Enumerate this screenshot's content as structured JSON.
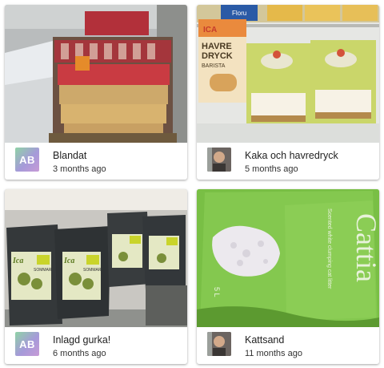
{
  "posts": [
    {
      "title": "Blandat",
      "time": "3 months ago",
      "avatar_initials": "AB",
      "image": "pallet-of-boxed-goods-in-snow"
    },
    {
      "title": "Kaka och havredryck",
      "time": "5 months ago",
      "avatar_initials": "",
      "image": "oat-drink-and-cakes-in-fridge"
    },
    {
      "title": "Inlagd gurka!",
      "time": "6 months ago",
      "avatar_initials": "AB",
      "image": "bags-of-pickled-cucumber"
    },
    {
      "title": "Kattsand",
      "time": "11 months ago",
      "avatar_initials": "",
      "image": "green-bag-of-cat-litter"
    }
  ],
  "photo_text": {
    "oat_carton_brand": "ICA",
    "oat_carton_line1": "HAVRE",
    "oat_carton_line2": "DRYCK",
    "oat_carton_line3": "BARISTA",
    "oat_carton_top": "Floru",
    "pickle_brand": "Ica",
    "pickle_label": "SOMMAR",
    "cat_brand": "Cattia",
    "cat_sub": "Scented white clumping cat litter",
    "cat_size": "5 L"
  }
}
